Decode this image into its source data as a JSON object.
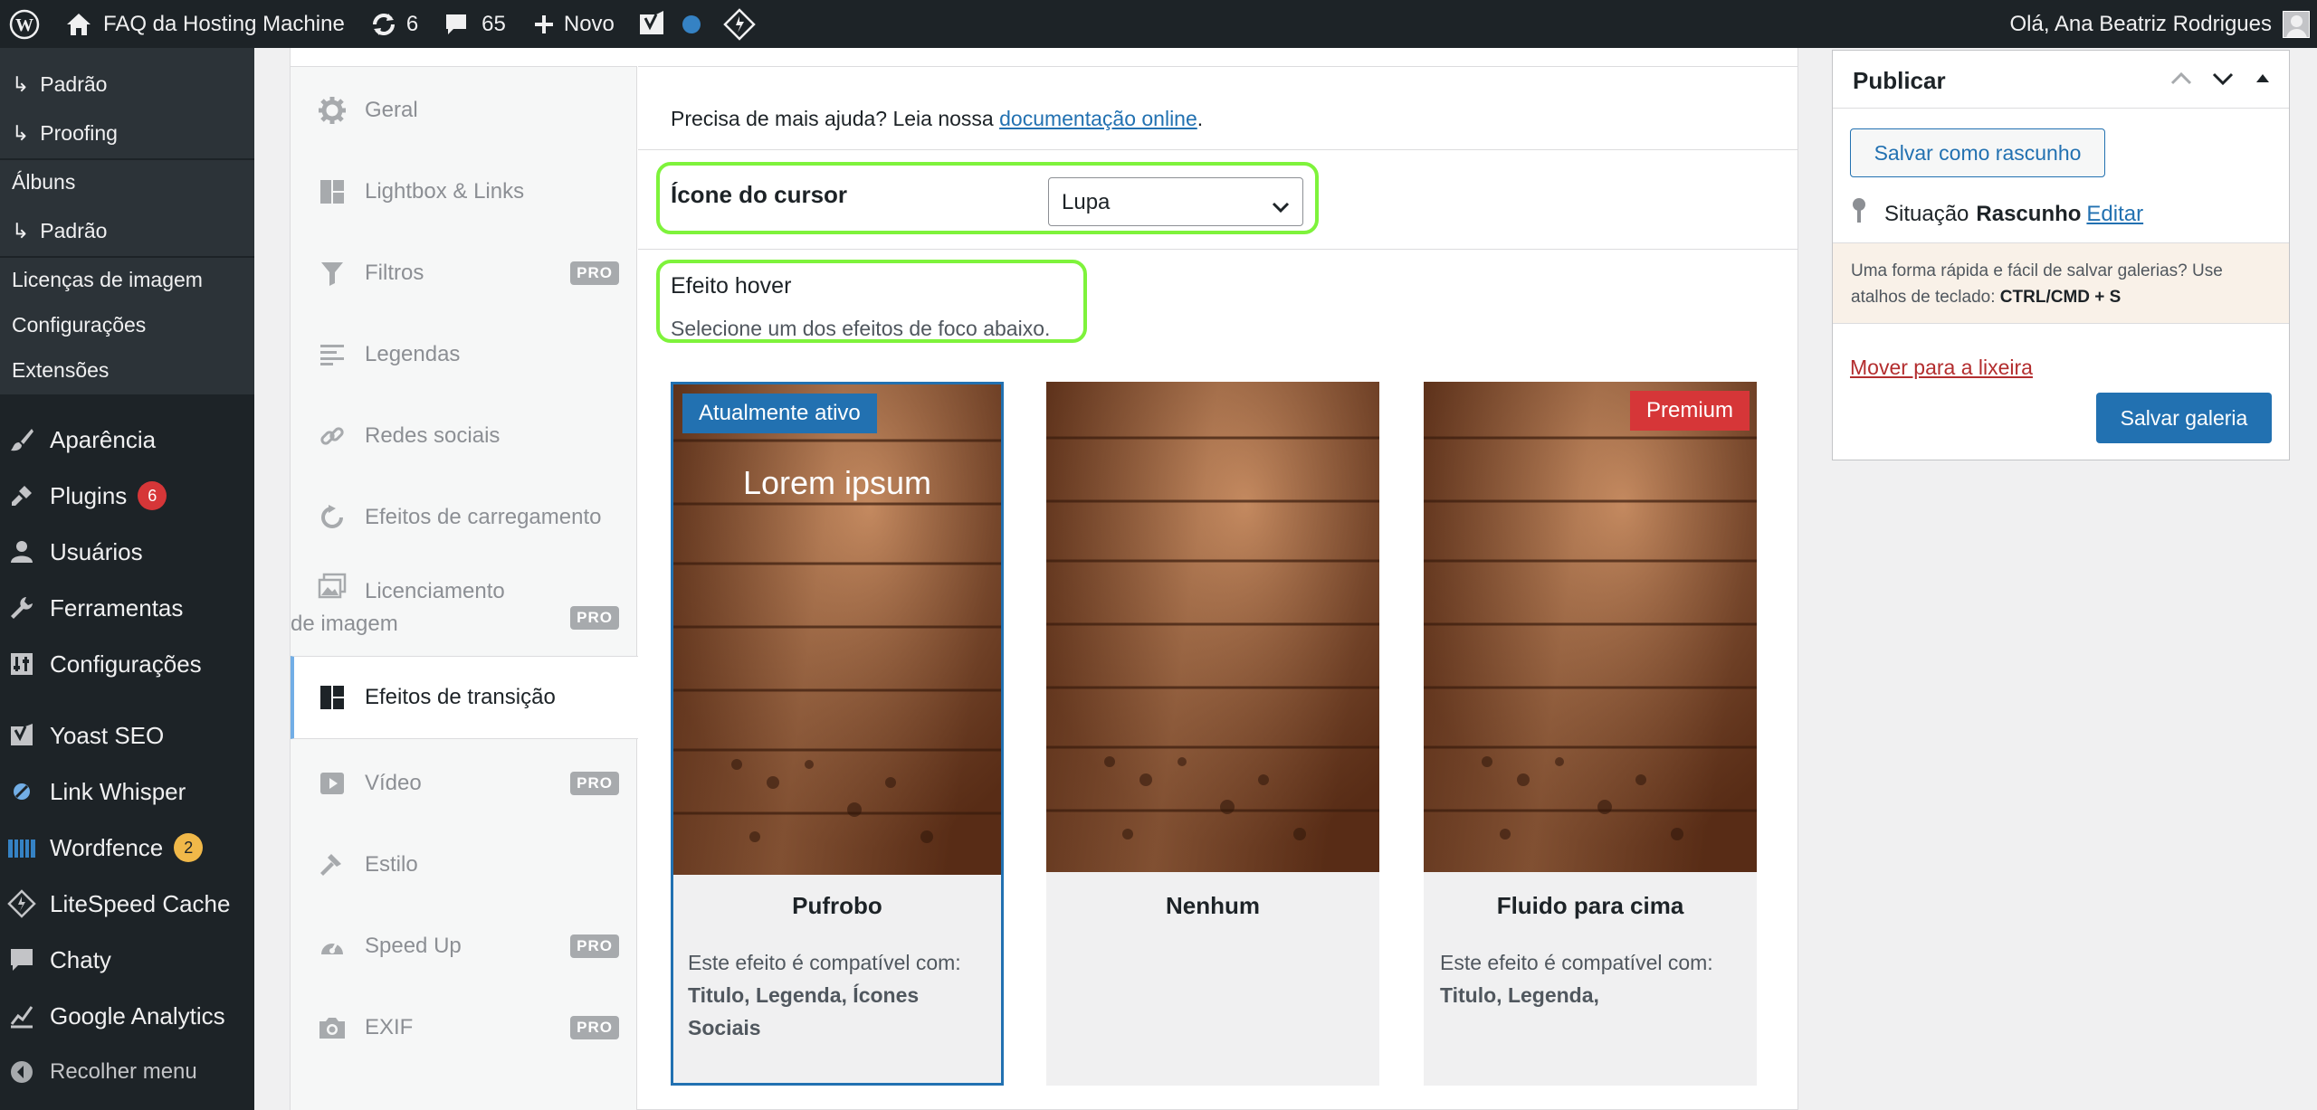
{
  "adminbar": {
    "site_name": "FAQ da Hosting Machine",
    "updates_count": "6",
    "comments_count": "65",
    "new_label": "Novo",
    "greeting": "Olá, Ana Beatriz Rodrigues"
  },
  "submenu": {
    "items": [
      "Padrão",
      "Proofing",
      "Álbuns",
      "Padrão",
      "Licenças de imagem",
      "Configurações",
      "Extensões"
    ]
  },
  "menu": {
    "items": [
      {
        "label": "Aparência",
        "icon": "paint-brush-icon"
      },
      {
        "label": "Plugins",
        "icon": "plugin-icon",
        "badge": "6"
      },
      {
        "label": "Usuários",
        "icon": "users-icon"
      },
      {
        "label": "Ferramentas",
        "icon": "wrench-icon"
      },
      {
        "label": "Configurações",
        "icon": "settings-icon"
      },
      {
        "label": "Yoast SEO",
        "icon": "yoast-icon"
      },
      {
        "label": "Link Whisper",
        "icon": "link-whisper-icon"
      },
      {
        "label": "Wordfence",
        "icon": "wordfence-icon",
        "badge": "2"
      },
      {
        "label": "LiteSpeed Cache",
        "icon": "litespeed-icon"
      },
      {
        "label": "Chaty",
        "icon": "chat-icon"
      },
      {
        "label": "Google Analytics",
        "icon": "analytics-icon"
      }
    ],
    "collapse_label": "Recolher menu"
  },
  "tabs": {
    "items": [
      {
        "label": "Geral",
        "icon": "gear-icon"
      },
      {
        "label": "Lightbox & Links",
        "icon": "grid-icon"
      },
      {
        "label": "Filtros",
        "icon": "filter-icon",
        "pro": "PRO"
      },
      {
        "label": "Legendas",
        "icon": "text-align-icon"
      },
      {
        "label": "Redes sociais",
        "icon": "link-icon"
      },
      {
        "label": "Efeitos de carregamento",
        "icon": "reload-icon"
      },
      {
        "label": "Licenciamento de imagem",
        "icon": "images-icon",
        "pro": "PRO"
      },
      {
        "label": "Efeitos de transição",
        "icon": "grid-icon",
        "active": true
      },
      {
        "label": "Vídeo",
        "icon": "video-icon",
        "pro": "PRO"
      },
      {
        "label": "Estilo",
        "icon": "hammer-icon"
      },
      {
        "label": "Speed Up",
        "icon": "dashboard-icon",
        "pro": "PRO"
      },
      {
        "label": "EXIF",
        "icon": "camera-icon",
        "pro": "PRO"
      }
    ]
  },
  "content": {
    "help_text": "Precisa de mais ajuda? Leia nossa ",
    "help_link": "documentação online",
    "help_suffix": ".",
    "cursor_label": "Ícone do cursor",
    "cursor_value": "Lupa",
    "hover_title": "Efeito hover",
    "hover_desc": "Selecione um dos efeitos de foco abaixo.",
    "cards": [
      {
        "title": "Pufrobo",
        "tag": "Atualmente ativo",
        "overlay": "Lorem ipsum",
        "compat_prefix": "Este efeito é compatível com:",
        "compat_items": "Titulo, Legenda, Ícones Sociais"
      },
      {
        "title": "Nenhum"
      },
      {
        "title": "Fluido para cima",
        "tag": "Premium",
        "compat_prefix": "Este efeito é compatível com:",
        "compat_items": "Titulo, Legenda,"
      }
    ]
  },
  "publish": {
    "title": "Publicar",
    "draft_button": "Salvar como rascunho",
    "status_label": "Situação",
    "status_value": "Rascunho",
    "edit_link": "Editar",
    "tip_text": "Uma forma rápida e fácil de salvar galerias? Use atalhos de teclado:",
    "tip_shortcut": "CTRL/CMD + S",
    "trash_link": "Mover para a lixeira",
    "save_button": "Salvar galeria"
  },
  "colors": {
    "accent": "#2271b1",
    "highlight": "#7ef33b",
    "danger": "#d63638",
    "adminbar": "#1d2327"
  }
}
